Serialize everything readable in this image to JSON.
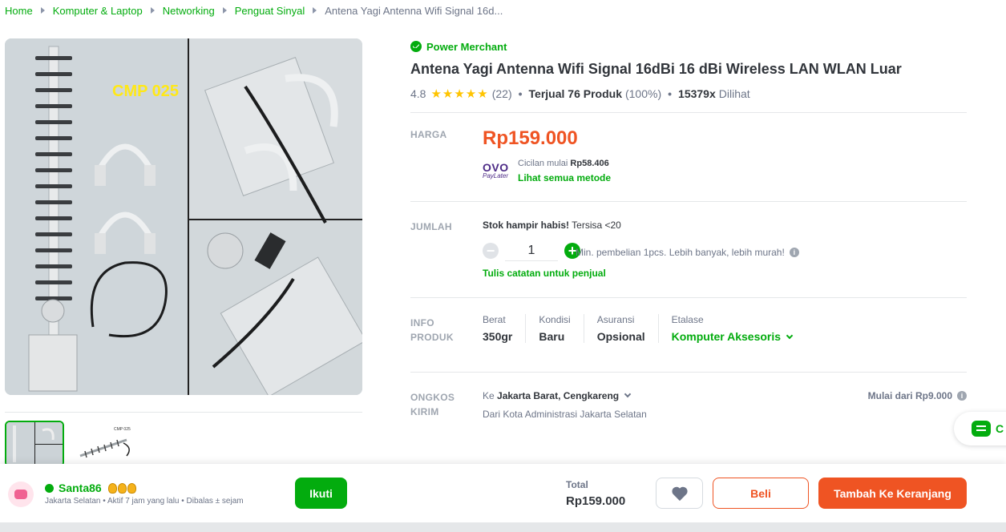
{
  "breadcrumb": {
    "items": [
      "Home",
      "Komputer & Laptop",
      "Networking",
      "Penguat Sinyal"
    ],
    "current": "Antena Yagi Antenna Wifi Signal 16d..."
  },
  "gallery": {
    "main_label": "CMP 025",
    "thumb_label": "CMP 025"
  },
  "product": {
    "badge": "Power Merchant",
    "title": "Antena Yagi Antenna Wifi Signal 16dBi 16 dBi Wireless LAN WLAN Luar",
    "rating": "4.8",
    "rating_count": "(22)",
    "sold_label": "Terjual 76 Produk",
    "sold_pct": "(100%)",
    "views_count": "15379x",
    "views_label": "Dilihat"
  },
  "price": {
    "label": "HARGA",
    "value": "Rp159.000",
    "ovo_logo": "OVO",
    "ovo_sub": "PayLater",
    "installment_prefix": "Cicilan mulai",
    "installment_value": "Rp58.406",
    "see_methods": "Lihat semua metode"
  },
  "quantity": {
    "label": "JUMLAH",
    "stock_warning": "Stok hampir habis!",
    "stock_rest": "Tersisa <20",
    "value": "1",
    "min_text": "Min. pembelian 1pcs. Lebih banyak, lebih murah!",
    "note_link": "Tulis catatan untuk penjual"
  },
  "product_info": {
    "label_line1": "INFO",
    "label_line2": "PRODUK",
    "attrs": [
      {
        "key": "Berat",
        "value": "350gr"
      },
      {
        "key": "Kondisi",
        "value": "Baru"
      },
      {
        "key": "Asuransi",
        "value": "Opsional"
      },
      {
        "key": "Etalase",
        "value": "Komputer Aksesoris"
      }
    ]
  },
  "shipping": {
    "label_line1": "ONGKOS",
    "label_line2": "KIRIM",
    "to_prefix": "Ke",
    "to_value": "Jakarta Barat, Cengkareng",
    "from": "Dari Kota Administrasi Jakarta Selatan",
    "price_from": "Mulai dari Rp9.000"
  },
  "chat": {
    "label": "C"
  },
  "shop": {
    "name": "Santa86",
    "sub": "Jakarta Selatan • Aktif 7 jam yang lalu • Dibalas ± sejam",
    "follow": "Ikuti"
  },
  "checkout": {
    "total_label": "Total",
    "total_value": "Rp159.000",
    "buy": "Beli",
    "add_to_cart": "Tambah Ke Keranjang"
  },
  "colors": {
    "accent_green": "#03ac0e",
    "accent_orange": "#ef5423",
    "star": "#ffc400",
    "ovo": "#4c2a86"
  }
}
